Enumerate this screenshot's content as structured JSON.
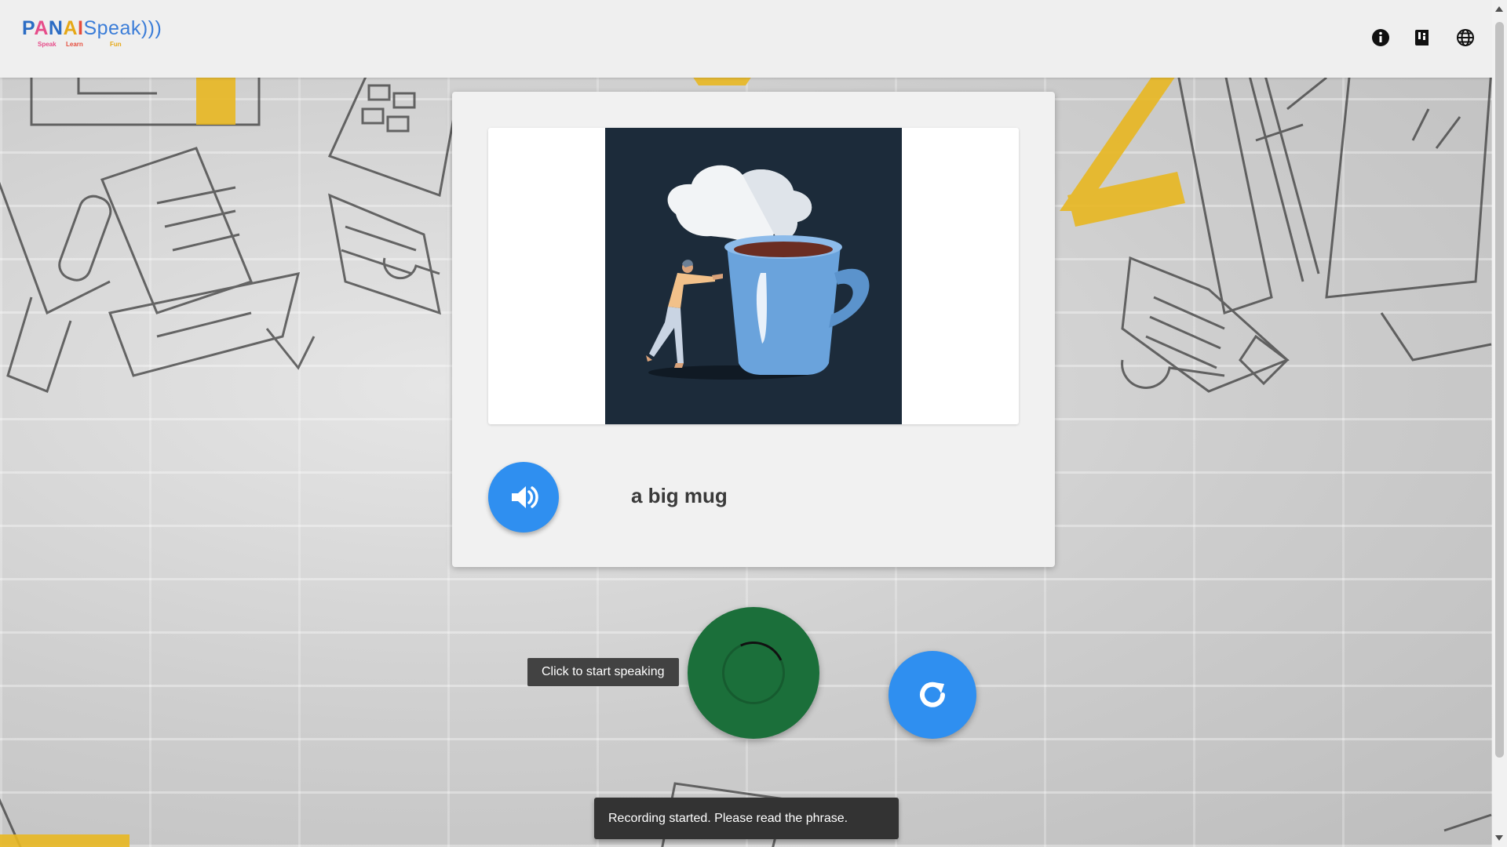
{
  "header": {
    "logo": {
      "main_parts": [
        "P",
        "A",
        "N",
        "A",
        "I",
        "Speak",
        ")))"
      ],
      "taglines": [
        "Speak",
        "Learn",
        "Fun"
      ]
    },
    "icons": [
      "info-icon",
      "dictionary-icon",
      "language-globe-icon"
    ]
  },
  "card": {
    "image_alt": "illustration-person-pushing-big-mug",
    "phrase": "a big mug",
    "play_icon": "volume-icon"
  },
  "controls": {
    "tooltip": "Click to start speaking",
    "mic_icon": "loading-spinner-icon",
    "reset_icon": "refresh-icon"
  },
  "snackbar": {
    "message": "Recording started. Please read the phrase."
  },
  "colors": {
    "header_bg": "#efefef",
    "card_bg": "#f1f1f1",
    "accent_blue": "#2f8ff0",
    "mic_green": "#1b6f3a",
    "illustration_bg": "#1c2b3a",
    "mug_blue": "#6aa3dc"
  }
}
